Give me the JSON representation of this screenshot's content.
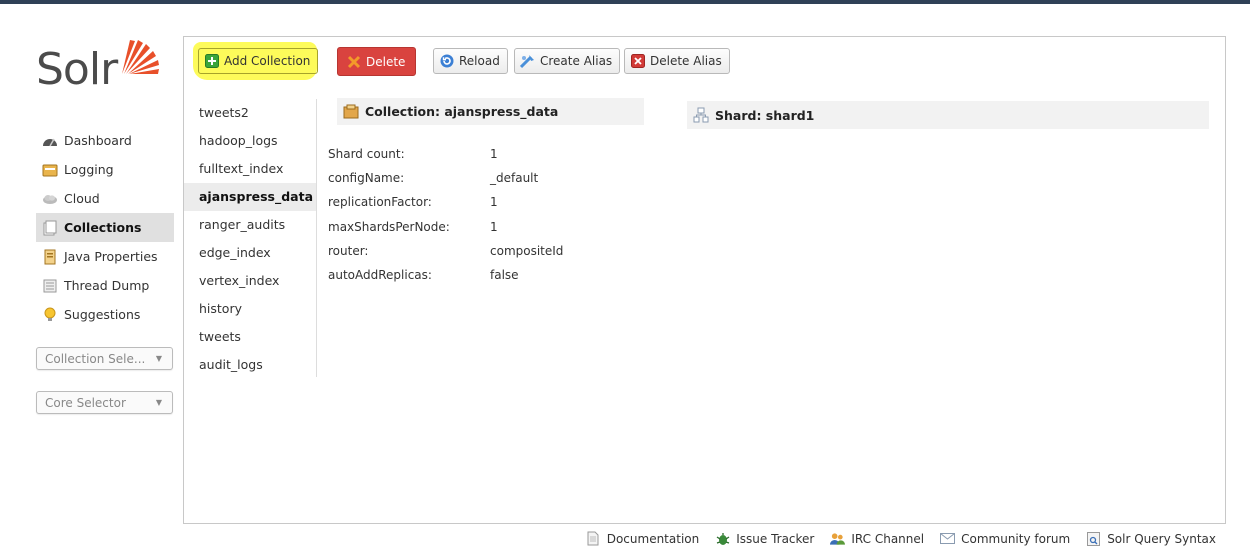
{
  "brand": {
    "logo_text": "Solr"
  },
  "nav": {
    "items": [
      {
        "label": "Dashboard",
        "icon": "dashboard-icon"
      },
      {
        "label": "Logging",
        "icon": "logging-icon"
      },
      {
        "label": "Cloud",
        "icon": "cloud-icon"
      },
      {
        "label": "Collections",
        "icon": "collections-icon",
        "active": true
      },
      {
        "label": "Java Properties",
        "icon": "java-properties-icon"
      },
      {
        "label": "Thread Dump",
        "icon": "thread-dump-icon"
      },
      {
        "label": "Suggestions",
        "icon": "suggestions-icon"
      }
    ],
    "collection_selector": "Collection Sele...",
    "core_selector": "Core Selector"
  },
  "toolbar": {
    "add_collection": "Add Collection",
    "delete": "Delete",
    "reload": "Reload",
    "create_alias": "Create Alias",
    "delete_alias": "Delete Alias"
  },
  "collections": [
    "tweets2",
    "hadoop_logs",
    "fulltext_index",
    "ajanspress_data",
    "ranger_audits",
    "edge_index",
    "vertex_index",
    "history",
    "tweets",
    "audit_logs"
  ],
  "selected_collection_index": 3,
  "collection": {
    "header": "Collection: ajanspress_data",
    "properties": [
      {
        "key": "Shard count:",
        "value": "1"
      },
      {
        "key": "configName:",
        "value": "_default"
      },
      {
        "key": "replicationFactor:",
        "value": "1"
      },
      {
        "key": "maxShardsPerNode:",
        "value": "1"
      },
      {
        "key": "router:",
        "value": "compositeId"
      },
      {
        "key": "autoAddReplicas:",
        "value": "false"
      }
    ]
  },
  "shard": {
    "header": "Shard: shard1"
  },
  "footer": {
    "links": [
      {
        "label": "Documentation",
        "icon": "document-icon"
      },
      {
        "label": "Issue Tracker",
        "icon": "bug-icon"
      },
      {
        "label": "IRC Channel",
        "icon": "users-icon"
      },
      {
        "label": "Community forum",
        "icon": "mail-icon"
      },
      {
        "label": "Solr Query Syntax",
        "icon": "query-syntax-icon"
      }
    ]
  },
  "colors": {
    "topbar": "#2f4157",
    "brand_orange": "#e8502a",
    "highlight": "#fdfb5a",
    "delete_red": "#d9433f"
  }
}
